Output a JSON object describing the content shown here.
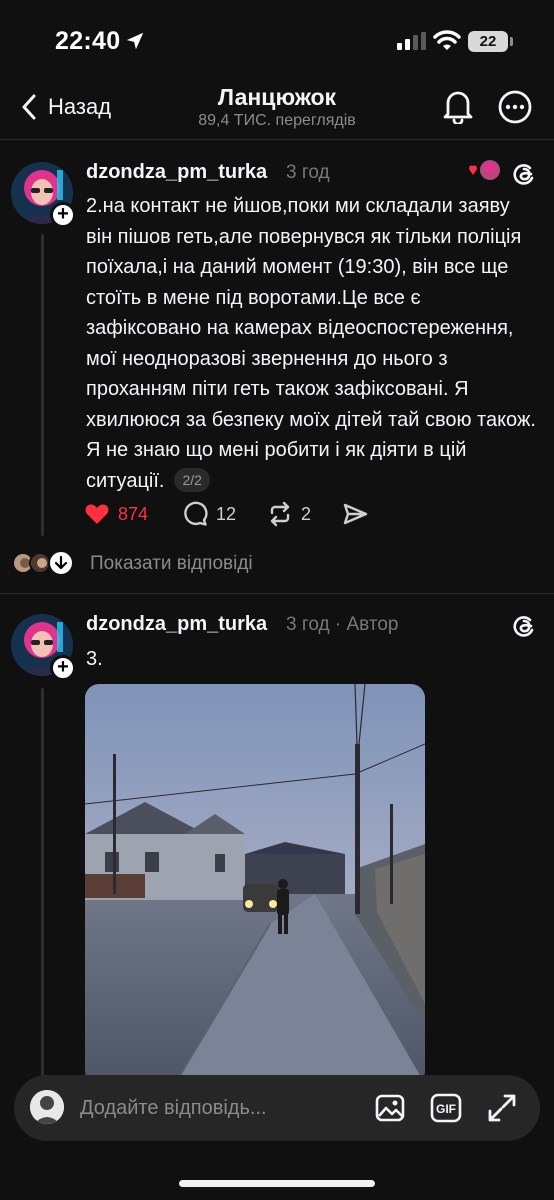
{
  "status_bar": {
    "time": "22:40",
    "battery": "22"
  },
  "header": {
    "back_label": "Назад",
    "title": "Ланцюжок",
    "subtitle": "89,4 ТИС. переглядів"
  },
  "post1": {
    "username": "dzondza_pm_turka",
    "time": "3 год",
    "text": "2.на контакт не йшов,поки ми складали заяву він пішов геть,але повернувся як тільки поліція поїхала,і на даний момент (19:30), він все ще стоїть в мене під воротами.Це все є зафіксовано на камерах відеоспостереження, мої неодноразові звернення до нього з проханням піти геть також зафіксовані. Я хвилююся за безпеку моїх дітей тай свою також. Я не знаю що мені робити і як діяти в цій ситуації.",
    "page_badge": "2/2",
    "likes": "874",
    "comments": "12",
    "reposts": "2",
    "liked": true
  },
  "show_replies": {
    "label": "Показати відповіді"
  },
  "post2": {
    "username": "dzondza_pm_turka",
    "meta": "3 год · Автор",
    "text": "3."
  },
  "reply_bar": {
    "placeholder": "Додайте відповідь..."
  },
  "colors": {
    "background": "#101010",
    "like_red": "#ff3040",
    "text_primary": "#f3f5f7",
    "text_secondary": "#777777"
  },
  "icons": [
    "location-arrow-icon",
    "signal-icon",
    "wifi-icon",
    "battery-icon",
    "chevron-left-icon",
    "bell-icon",
    "more-icon",
    "threads-icon",
    "heart-icon",
    "comment-icon",
    "repost-icon",
    "share-icon",
    "plus-icon",
    "chevron-down-icon",
    "image-icon",
    "gif-icon",
    "expand-icon"
  ]
}
